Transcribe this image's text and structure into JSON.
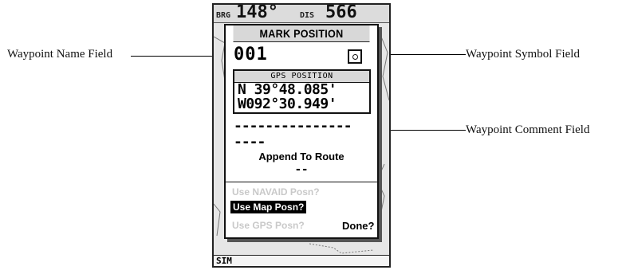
{
  "callouts": {
    "waypoint_name": "Waypoint Name Field",
    "waypoint_symbol": "Waypoint Symbol Field",
    "waypoint_comment": "Waypoint Comment  Field"
  },
  "device": {
    "top_strip": {
      "brg_label": "BRG",
      "brg_value": "148°",
      "dis_label": "DIS",
      "dis_value": "566"
    },
    "status_bar": "SIM"
  },
  "dialog": {
    "title": "MARK POSITION",
    "waypoint_name": "001",
    "waypoint_symbol_icon": "small-circle-icon",
    "gps_position": {
      "title": "GPS POSITION",
      "latitude": "N 39°48.085'",
      "longitude": "W092°30.949'"
    },
    "comment_line1": "---------------",
    "comment_line2": "----",
    "append_to_route": "Append To Route",
    "append_value": "--",
    "options": {
      "navaid": "Use NAVAID Posn?",
      "map": "Use Map Posn?",
      "gps": "Use GPS Posn?"
    },
    "done": "Done?"
  }
}
